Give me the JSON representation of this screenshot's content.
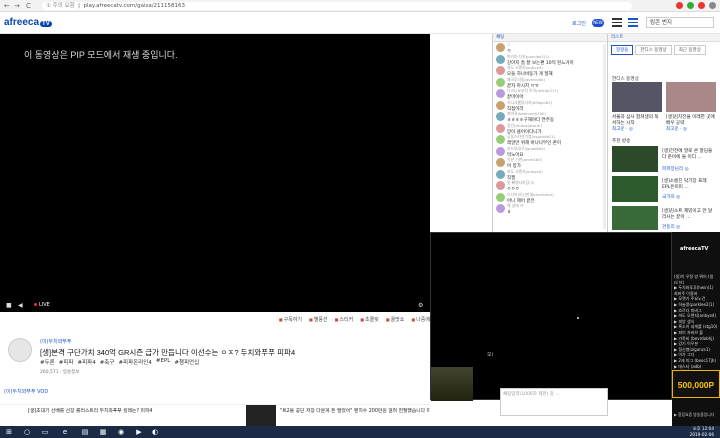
{
  "browser": {
    "back": "←",
    "forward": "→",
    "reload": "C",
    "url_prefix": "① 주의 요함",
    "url": "play.afreecatv.com/gaisa/211158163"
  },
  "header": {
    "logo": "afreeca",
    "logo_tv": "TV",
    "login": "로그인",
    "badge": "NEW",
    "search_value": "링콘 번지"
  },
  "player": {
    "pip_message": "이 동영상은 PIP 모드에서 재생 중입니다.",
    "live_label": "LIVE"
  },
  "below": {
    "actions": [
      "구독하기",
      "별풍선",
      "스티커",
      "초콜릿",
      "꿀맛쇼",
      "나중에"
    ],
    "bj_name": "(이)두치와푸푸",
    "title": "[생]본격 구단가치 340억 GR시즌 급가 만듭니다 이선수는 ㅇㅈ? 두치와푸푸 피파4",
    "tags": [
      "#두론",
      "#피파",
      "#피파4",
      "#축구",
      "#피파온라인4",
      "#EPL",
      "#챔피언십"
    ],
    "stats": "260,571 · 방송정보",
    "vod_label": "(이)두치와푸푸 VOD",
    "vod_items": [
      "[생]초대기 선배를 선장 롤러스트리 두치와푸푸 킬레는? 피파4",
      "\"트2볼 공단 저장 다문게 돈 팔었어\" 팬치수 200만원 걸려 헌절했습니다 피파4"
    ]
  },
  "chat": {
    "header": "채팅",
    "messages": [
      {
        "nick": "ㅇ",
        "text": "ㅇ"
      },
      {
        "nick": "마리아 디카(parklee2(1)",
        "text": "강아지 흠 잘 보는편 10억 된느거미"
      },
      {
        "nick": "까도 오렌지(onbye4)",
        "text": "오들 하나바둥가 게 질해"
      },
      {
        "nick": "매국투더킹(avercodo)",
        "text": "끝자 마시지 ㅠㅠ"
      },
      {
        "nick": "다크니뉴부릭 토이(mikib(217)",
        "text": "끝마이어"
      },
      {
        "nick": "유니크했었사자(dflogin82)",
        "text": "직접이러"
      },
      {
        "nick": "까마귀(bennmdl(300)",
        "text": "ㅎㅎㅎㅎ구해야다 연주동"
      },
      {
        "nick": "경인(drums(ato(dr)",
        "text": "망이 클어이다니가"
      },
      {
        "nick": "공동스타연기캡(hsgshdb21)",
        "text": "레알만 위해 바나나무인 존이"
      },
      {
        "nick": "미드모대구(lgneokb0)",
        "text": "먹노어요"
      },
      {
        "nick": "이판 기관(arcm4b0)",
        "text": "어 망가"
      },
      {
        "nick": "까도 오렌지(onbye4)",
        "text": "직필"
      },
      {
        "nick": "옷 빠발다라당(3)",
        "text": "ㅇㅇㅇ"
      },
      {
        "nick": "드디어(아닌만세(dxcfbnb4)",
        "text": "아니 헤어 끝은"
      },
      {
        "nick": "해 상태 가",
        "text": "ㅎ"
      }
    ]
  },
  "right": {
    "header": "리스트",
    "tabs": [
      "정왕들",
      "한디스 동영상",
      "최근 동영상"
    ],
    "featured_label": "한디스 동영상",
    "items": [
      {
        "title": "서울과 삼사 합쳐생의 독서하는 시작",
        "by": "최고운 · ◎"
      },
      {
        "title": "[생]김치전을 이레한 곳에 배우 공략",
        "by": "최고운 · ◎"
      }
    ],
    "section_label": "추천 방송",
    "list": [
      {
        "title": "[생]건전에 말로 콘 깔딩을 다 준비에 들 이디 ...",
        "by": "피파장님리 ◎"
      },
      {
        "title": "[생]소름진 탁기장 프레 EPL은미미 ...",
        "by": "국가자 ◎"
      },
      {
        "title": "[생]김소트 제밌이고 만 달리사는 끝이 ...",
        "by": "관동리 ◎"
      }
    ]
  },
  "pip": {
    "chat_placeholder": "채팅입력(1000자 제한) 중 ...",
    "small_label": "오i"
  },
  "side_panel": {
    "title": "afreecaTV",
    "lines": [
      "(생)이 우정 방 뛰어 (생",
      "nl 브)",
      "▶ 두치와푸푸(hwin(1)",
      "최비주 이용바",
      "▶ 모랫기 주요노건",
      "▶ 하늘풍(parklee2(1)",
      "▶ 흐르다 피버그",
      "▶ 까도 오렌지(onbye4)",
      "▶ 피양 생식",
      "▶ 흑소이 네게를 (stg10)",
      "▶ 파이 자바브 볼",
      "▶ 가족비 (bevrdobhj)",
      "▶ 강기 이우분",
      "▶ 정신병(ziganzs1)",
      "▶ 이가 그다",
      "▶ 2세 미그 (beoc17jh)",
      "▶ 데스타 (adb)",
      "▶ 가이바"
    ],
    "ad_value": "500,000P",
    "footer": "▶ 환장요즘 방송중입니다"
  },
  "taskbar": {
    "time": "오후 12:04",
    "date": "2019-02-06"
  },
  "colors": {
    "accent": "#1a56c8",
    "player_bg": "#000000",
    "taskbar": "#1b2a45",
    "ad_gold": "#ffc400"
  }
}
